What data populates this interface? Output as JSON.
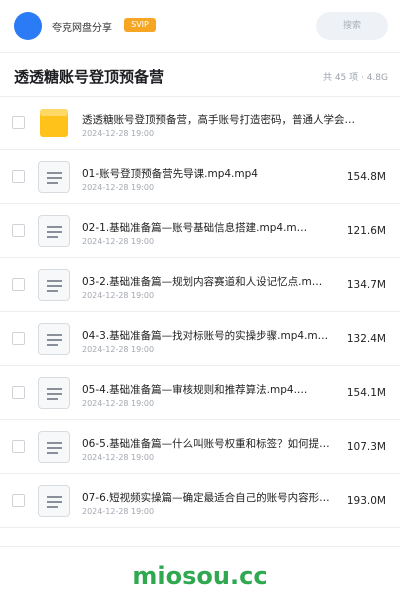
{
  "header": {
    "app_name": "夸克网盘分享",
    "badge": "SVIP",
    "search_placeholder": "搜索"
  },
  "folder": {
    "title": "透透糖账号登顶预备营",
    "meta": "共 45 项 · 4.8G"
  },
  "files": [
    {
      "icon": "folder-icon",
      "name": "透透糖账号登顶预备营，高手账号打造密码，普通人学会…",
      "date": "2024-12-28 19:00",
      "size": ""
    },
    {
      "icon": "document-icon",
      "name": "01-账号登顶预备营先导课.mp4.mp4",
      "date": "2024-12-28 19:00",
      "size": "154.8M"
    },
    {
      "icon": "document-icon",
      "name": "02-1.基础准备篇—账号基础信息搭建.mp4.m…",
      "date": "2024-12-28 19:00",
      "size": "121.6M"
    },
    {
      "icon": "document-icon",
      "name": "03-2.基础准备篇—规划内容赛道和人设记忆点.m…",
      "date": "2024-12-28 19:00",
      "size": "134.7M"
    },
    {
      "icon": "document-icon",
      "name": "04-3.基础准备篇—找对标账号的实操步骤.mp4.m…",
      "date": "2024-12-28 19:00",
      "size": "132.4M"
    },
    {
      "icon": "document-icon",
      "name": "05-4.基础准备篇—审核规则和推荐算法.mp4.…",
      "date": "2024-12-28 19:00",
      "size": "154.1M"
    },
    {
      "icon": "document-icon",
      "name": "06-5.基础准备篇—什么叫账号权重和标签？如何提…",
      "date": "2024-12-28 19:00",
      "size": "107.3M"
    },
    {
      "icon": "document-icon",
      "name": "07-6.短视频实操篇—确定最适合自己的账号内容形…",
      "date": "2024-12-28 19:00",
      "size": "193.0M"
    }
  ],
  "watermark": "miosou.cc",
  "colors": {
    "avatar": "#2b7bf6",
    "badge": "#f6a623",
    "folder": "#ffc21a",
    "watermark": "#2fa84f"
  }
}
